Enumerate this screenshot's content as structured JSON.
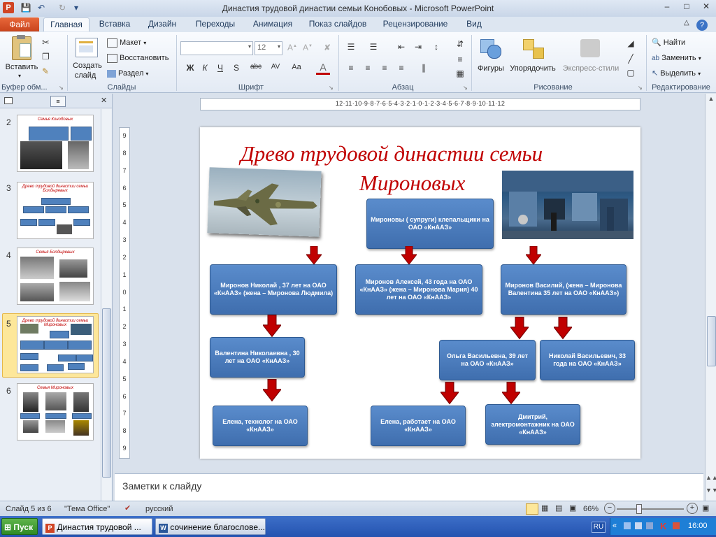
{
  "window": {
    "title": "Династия трудовой династии семьи Конобовых - Microsoft PowerPoint"
  },
  "ribbon": {
    "file_tab": "Файл",
    "tabs": [
      "Главная",
      "Вставка",
      "Дизайн",
      "Переходы",
      "Анимация",
      "Показ слайдов",
      "Рецензирование",
      "Вид"
    ],
    "paste": "Вставить",
    "new_slide_1": "Создать",
    "new_slide_2": "слайд",
    "layout": "Макет",
    "reset": "Восстановить",
    "section": "Раздел",
    "font_size": "12",
    "shapes": "Фигуры",
    "arrange": "Упорядочить",
    "quick_styles": "Экспресс-стили",
    "find": "Найти",
    "replace": "Заменить",
    "select": "Выделить",
    "groups": {
      "clipboard": "Буфер обм...",
      "slides": "Слайды",
      "font": "Шрифт",
      "paragraph": "Абзац",
      "drawing": "Рисование",
      "editing": "Редактирование"
    }
  },
  "ruler": {
    "h_labels": "12·11·10·9·8·7·6·5·4·3·2·1·0·1·2·3·4·5·6·7·8·9·10·11·12",
    "v_labels": [
      "9",
      "8",
      "7",
      "6",
      "5",
      "4",
      "3",
      "2",
      "1",
      "0",
      "1",
      "2",
      "3",
      "4",
      "5",
      "6",
      "7",
      "8",
      "9"
    ]
  },
  "slides_panel": {
    "thumbs": [
      {
        "num": "2",
        "title": "Семья Конобовых"
      },
      {
        "num": "3",
        "title": "Древо трудовой династии семьи Болдыревых"
      },
      {
        "num": "4",
        "title": "Семья Болдыревых"
      },
      {
        "num": "5",
        "title": "Древо трудовой династии семьи Мироновых"
      },
      {
        "num": "6",
        "title": "Семья Мироновых"
      }
    ]
  },
  "slide": {
    "title_line1": "Древо трудовой династии семьи",
    "title_line2": "Мироновых",
    "boxes": {
      "parents": "Мироновы ( супруги) клепальщики на ОАО «КнААЗ»",
      "nikolay": "Миронов Николай , 37 лет на ОАО «КнААЗ» (жена – Миронова Людмила)",
      "aleksey": "Миронов Алексей, 43 года на ОАО «КнААЗ» (жена – Миронова Мария) 40 лет на ОАО «КнААЗ»",
      "vasiliy": "Миронов Василий, (жена – Миронова Валентина 35 лет на ОАО «КнААЗ»)",
      "valentina": "Валентина Николаевна , 30 лет на ОАО «КнААЗ»",
      "olga": "Ольга Васильевна, 39 лет на ОАО «КнААЗ»",
      "nikolay_v": "Николай Васильевич, 33 года на ОАО «КнААЗ»",
      "elena1": "Елена, технолог на ОАО «КнААЗ»",
      "elena2": "Елена, работает на ОАО «КнААЗ»",
      "dmitriy": "Дмитрий, электромонтажник на ОАО «КнААЗ»"
    }
  },
  "notes": {
    "placeholder": "Заметки к слайду"
  },
  "status": {
    "slide": "Слайд 5 из 6",
    "theme": "\"Тема Office\"",
    "lang": "русский",
    "zoom": "66%"
  },
  "taskbar": {
    "start": "Пуск",
    "app1": "Династия трудовой ...",
    "app2": "сочинение благослове...",
    "lang": "RU",
    "clock": "16:00"
  },
  "colors": {
    "accent": "#c00000",
    "box": "#4f81bd",
    "arrow": "#c00000"
  }
}
